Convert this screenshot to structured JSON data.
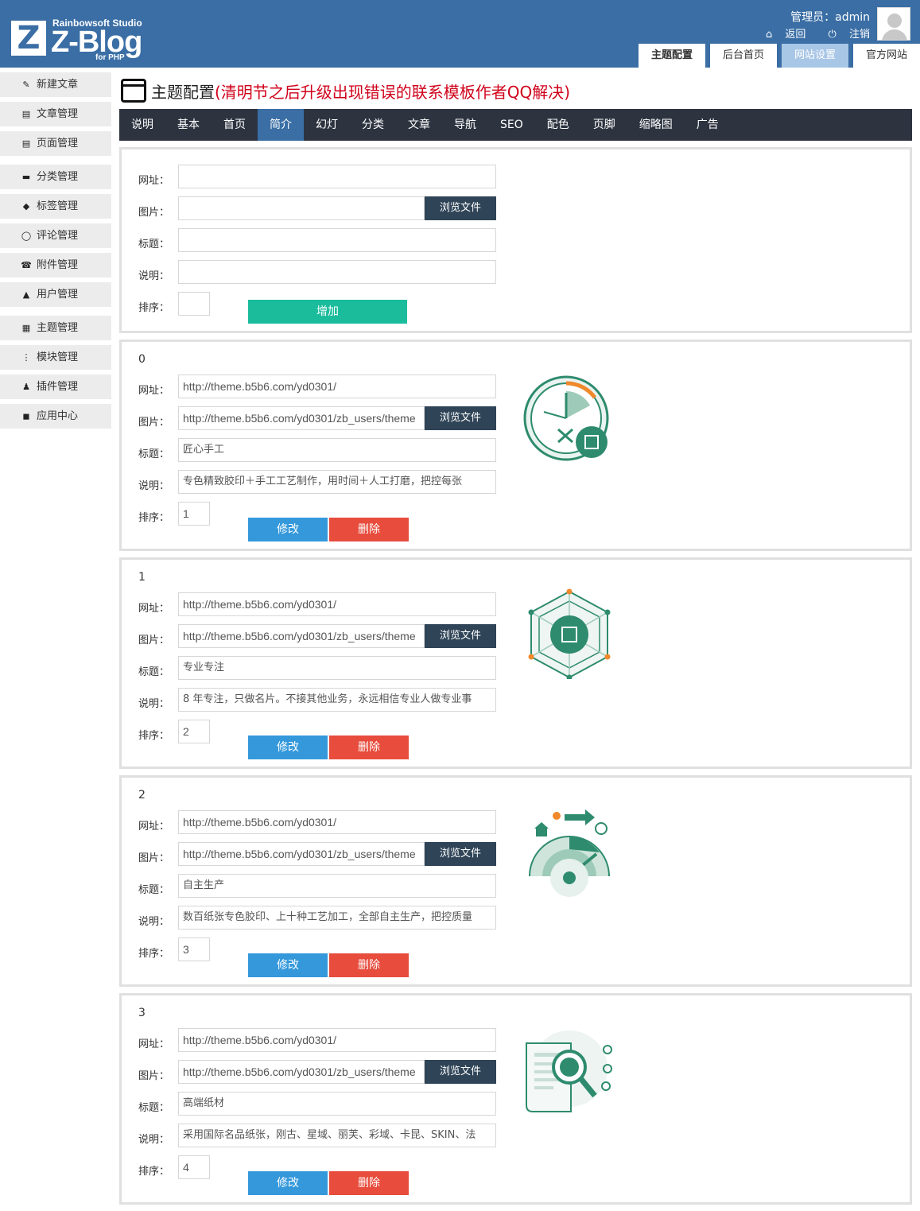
{
  "header": {
    "logo": {
      "mark": "Z",
      "studio": "Rainbowsoft Studio",
      "name": "Z-Blog",
      "for": "for PHP"
    },
    "user_line": "管理员：admin",
    "links": [
      {
        "icon": "home-icon",
        "glyph": "⌂",
        "label": "返回"
      },
      {
        "icon": "power-icon",
        "glyph": "⏻",
        "label": "注销"
      }
    ],
    "tabs": [
      "主题配置",
      "后台首页",
      "网站设置",
      "官方网站"
    ]
  },
  "sidebar": {
    "items": [
      {
        "icon": "edit-icon",
        "glyph": "✎",
        "label": "新建文章"
      },
      {
        "icon": "document-icon",
        "glyph": "▤",
        "label": "文章管理"
      },
      {
        "icon": "page-icon",
        "glyph": "▤",
        "label": "页面管理"
      },
      {
        "icon": "folder-icon",
        "glyph": "▬",
        "label": "分类管理"
      },
      {
        "icon": "tag-icon",
        "glyph": "◆",
        "label": "标签管理"
      },
      {
        "icon": "comment-icon",
        "glyph": "◯",
        "label": "评论管理"
      },
      {
        "icon": "attachment-icon",
        "glyph": "☎",
        "label": "附件管理"
      },
      {
        "icon": "user-icon",
        "glyph": "▲",
        "label": "用户管理"
      },
      {
        "icon": "theme-icon",
        "glyph": "▦",
        "label": "主题管理"
      },
      {
        "icon": "module-icon",
        "glyph": "⋮",
        "label": "模块管理"
      },
      {
        "icon": "plugin-icon",
        "glyph": "♟",
        "label": "插件管理"
      },
      {
        "icon": "app-center-icon",
        "glyph": "◼",
        "label": "应用中心"
      }
    ]
  },
  "page": {
    "title": "主题配置",
    "title_note": "(清明节之后升级出现错误的联系模板作者QQ解决)"
  },
  "tabs": [
    "说明",
    "基本",
    "首页",
    "简介",
    "幻灯",
    "分类",
    "文章",
    "导航",
    "SEO",
    "配色",
    "页脚",
    "缩略图",
    "广告"
  ],
  "form_labels": {
    "url": "网址：",
    "image": "图片：",
    "title": "标题：",
    "desc": "说明：",
    "order": "排序："
  },
  "buttons": {
    "browse": "浏览文件",
    "add": "增加",
    "edit": "修改",
    "delete": "删除"
  },
  "new_item": {
    "url": "",
    "image": "",
    "title": "",
    "desc": "",
    "order": ""
  },
  "items": [
    {
      "index": "0",
      "url": "http://theme.b5b6.com/yd0301/",
      "image": "http://theme.b5b6.com/yd0301/zb_users/theme",
      "title": "匠心手工",
      "desc": "专色精致胶印＋手工工艺制作，用时间＋人工打磨，把控每张",
      "order": "1",
      "icon": "clock-tools-icon"
    },
    {
      "index": "1",
      "url": "http://theme.b5b6.com/yd0301/",
      "image": "http://theme.b5b6.com/yd0301/zb_users/theme",
      "title": "专业专注",
      "desc": "8 年专注，只做名片。不接其他业务，永远相信专业人做专业事",
      "order": "2",
      "icon": "hexagon-network-icon"
    },
    {
      "index": "2",
      "url": "http://theme.b5b6.com/yd0301/",
      "image": "http://theme.b5b6.com/yd0301/zb_users/theme",
      "title": "自主生产",
      "desc": "数百纸张专色胶印、上十种工艺加工，全部自主生产，把控质量",
      "order": "3",
      "icon": "gauge-production-icon"
    },
    {
      "index": "3",
      "url": "http://theme.b5b6.com/yd0301/",
      "image": "http://theme.b5b6.com/yd0301/zb_users/theme",
      "title": "高端纸材",
      "desc": "采用国际名品纸张，刚古、星域、丽芙、彩域、卡昆、SKIN、法",
      "order": "4",
      "icon": "paper-magnifier-icon"
    }
  ],
  "colors": {
    "header_bg": "#3a6ea5",
    "tabbar_bg": "#2d3440",
    "tab_active": "#3a6ea5",
    "browse_btn": "#2f4457",
    "add_btn": "#1abc9c",
    "edit_btn": "#3498db",
    "delete_btn": "#e74c3c",
    "title_note": "#d0021b",
    "icon_green": "#2e8b6e"
  }
}
